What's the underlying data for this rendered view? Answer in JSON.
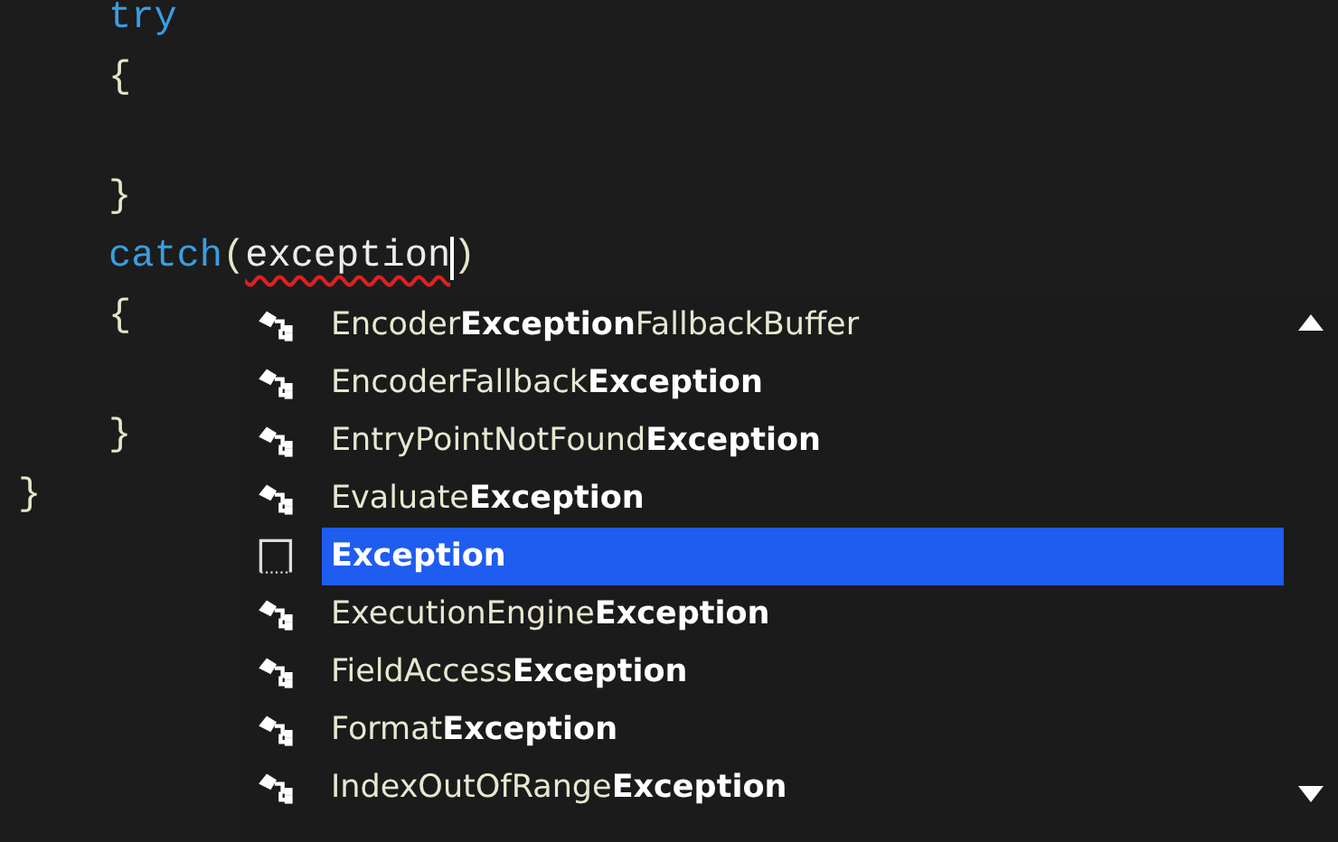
{
  "code_lines": [
    {
      "tokens": [
        {
          "text": "try",
          "kind": "keyword"
        }
      ]
    },
    {
      "tokens": [
        {
          "text": "{",
          "kind": "punct"
        }
      ]
    },
    {
      "blank_line_before": true,
      "tokens": [
        {
          "text": "}",
          "kind": "punct"
        }
      ]
    },
    {
      "tokens": [
        {
          "text": "catch",
          "kind": "keyword"
        },
        {
          "text": "(",
          "kind": "punct"
        },
        {
          "text": "exception",
          "kind": "error",
          "caret": true
        },
        {
          "text": ")",
          "kind": "punct"
        }
      ]
    },
    {
      "tokens": [
        {
          "text": "{",
          "kind": "punct"
        }
      ]
    },
    {
      "blank_line_before": true,
      "tokens": [
        {
          "text": "}",
          "kind": "punct"
        }
      ]
    },
    {
      "outdent": true,
      "tokens": [
        {
          "text": "}",
          "kind": "punct"
        }
      ]
    }
  ],
  "completion": {
    "items": [
      {
        "kind": "class",
        "selected": false,
        "label": "Encoder**Exception**FallbackBuffer"
      },
      {
        "kind": "class",
        "selected": false,
        "label": "EncoderFallback**Exception**"
      },
      {
        "kind": "class",
        "selected": false,
        "label": "EntryPointNotFound**Exception**"
      },
      {
        "kind": "class",
        "selected": false,
        "label": "Evaluate**Exception**"
      },
      {
        "kind": "snippet",
        "selected": true,
        "label": "**Exception**"
      },
      {
        "kind": "class",
        "selected": false,
        "label": "ExecutionEngine**Exception**"
      },
      {
        "kind": "class",
        "selected": false,
        "label": "FieldAccess**Exception**"
      },
      {
        "kind": "class",
        "selected": false,
        "label": "Format**Exception**"
      },
      {
        "kind": "class",
        "selected": false,
        "label": "IndexOutOfRange**Exception**"
      }
    ]
  }
}
